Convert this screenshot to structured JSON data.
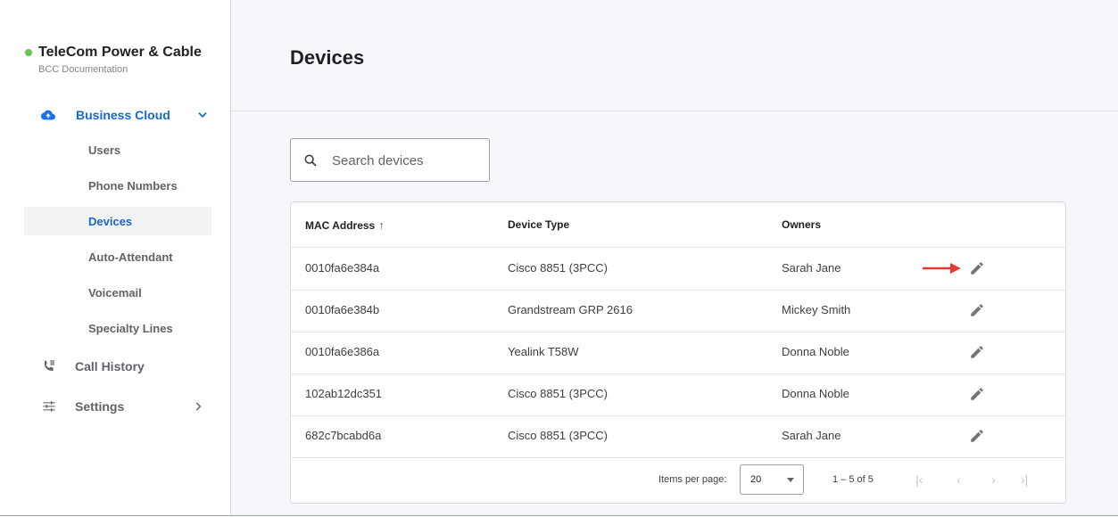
{
  "org": {
    "name": "TeleCom Power & Cable",
    "subtitle": "BCC Documentation",
    "status_color": "#6cc24a"
  },
  "sidebar": {
    "group": {
      "label": "Business Cloud",
      "icon": "cloud-icon",
      "chevron": "chevron-down-icon"
    },
    "sub_items": [
      {
        "label": "Users",
        "active": false
      },
      {
        "label": "Phone Numbers",
        "active": false
      },
      {
        "label": "Devices",
        "active": true
      },
      {
        "label": "Auto-Attendant",
        "active": false
      },
      {
        "label": "Voicemail",
        "active": false
      },
      {
        "label": "Specialty Lines",
        "active": false
      }
    ],
    "call_history": {
      "label": "Call History",
      "icon": "call-history-icon"
    },
    "settings": {
      "label": "Settings",
      "icon": "settings-sliders-icon",
      "chevron": "chevron-right-icon"
    }
  },
  "page": {
    "title": "Devices"
  },
  "search": {
    "placeholder": "Search devices",
    "icon": "search-icon"
  },
  "table": {
    "headers": {
      "mac": "MAC Address",
      "mac_sort": "↑",
      "type": "Device Type",
      "owners": "Owners"
    },
    "rows": [
      {
        "mac": "0010fa6e384a",
        "type": "Cisco 8851 (3PCC)",
        "owner": "Sarah Jane"
      },
      {
        "mac": "0010fa6e384b",
        "type": "Grandstream GRP 2616",
        "owner": "Mickey Smith"
      },
      {
        "mac": "0010fa6e386a",
        "type": "Yealink T58W",
        "owner": "Donna Noble"
      },
      {
        "mac": "102ab12dc351",
        "type": "Cisco 8851 (3PCC)",
        "owner": "Donna Noble"
      },
      {
        "mac": "682c7bcabd6a",
        "type": "Cisco 8851 (3PCC)",
        "owner": "Sarah Jane"
      }
    ],
    "edit_icon": "pencil-edit-icon",
    "annotation_arrow_color": "#e53935"
  },
  "pagination": {
    "items_per_page_label": "Items per page:",
    "items_per_page": "20",
    "range": "1 – 5 of 5",
    "first": "|‹",
    "prev": "‹",
    "next": "›",
    "last": "›|"
  },
  "colors": {
    "accent": "#1967d2",
    "main_bg": "#f5f7fa"
  }
}
